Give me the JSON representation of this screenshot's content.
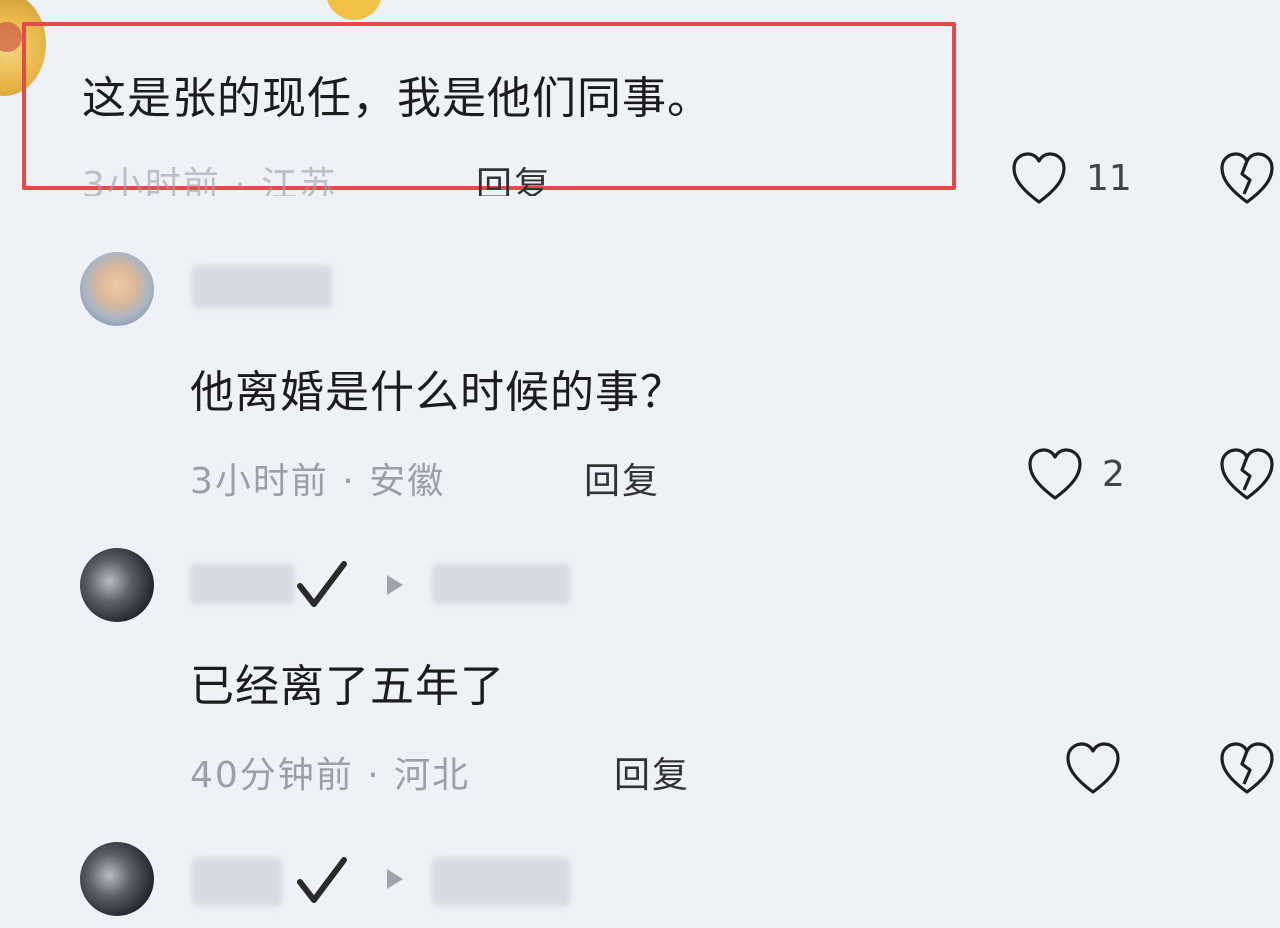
{
  "comments": [
    {
      "text": "这是张的现任，我是他们同事。",
      "meta": "3小时前 · 江苏",
      "reply": "回复",
      "likes": "11",
      "highlighted": true
    },
    {
      "text": "他离婚是什么时候的事？",
      "meta": "3小时前 · 安徽",
      "reply": "回复",
      "likes": "2"
    },
    {
      "text": "已经离了五年了",
      "meta": "40分钟前 · 河北",
      "reply": "回复",
      "likes": ""
    }
  ],
  "icons": {
    "like": "heart-outline-icon",
    "dislike": "broken-heart-icon",
    "verified": "checkmark-icon",
    "reply_arrow": "play-arrow-icon"
  },
  "colors": {
    "highlight_border": "#e44a4a",
    "background": "#eef1f5",
    "meta_text": "#9aa0a8"
  }
}
